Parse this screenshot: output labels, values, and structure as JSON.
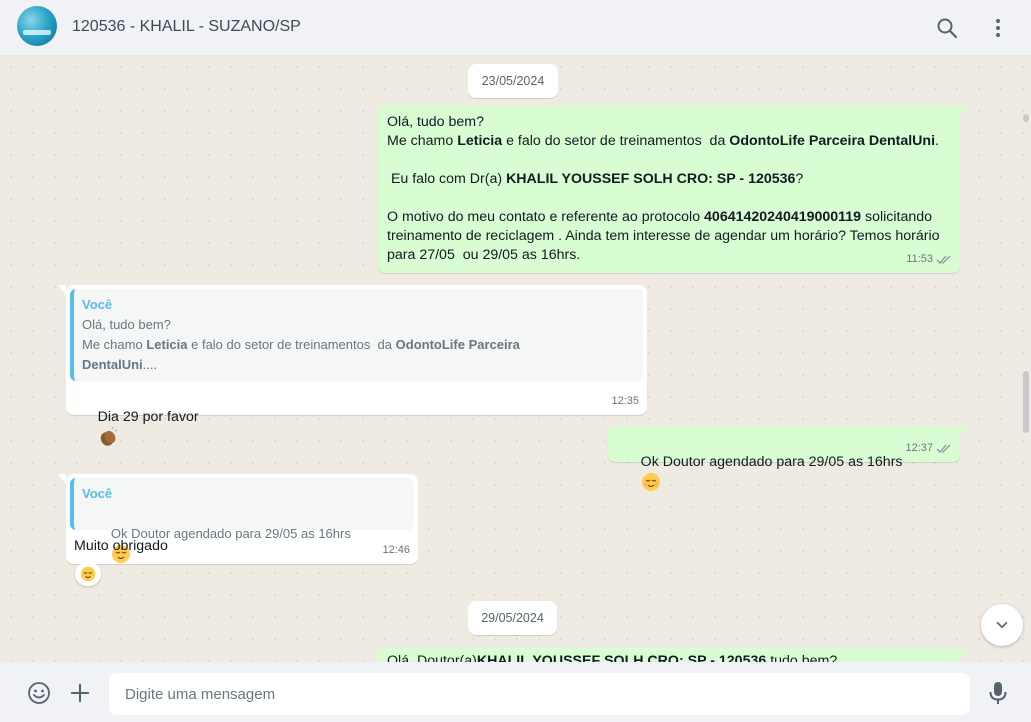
{
  "header": {
    "title": "120536 - KHALIL - SUZANO/SP",
    "search_icon": "search-icon",
    "menu_icon": "menu-dots-icon"
  },
  "chat": {
    "date_1": "23/05/2024",
    "date_2": "29/05/2024",
    "msg1": {
      "l1": "Olá, tudo bem?",
      "l2a": "Me chamo ",
      "l2b": "Leticia",
      "l2c": " e falo do setor de treinamentos  da ",
      "l2d": "OdontoLife Parceira DentalUni",
      "l2e": ".",
      "l3a": " Eu falo com Dr(a) ",
      "l3b": "KHALIL YOUSSEF SOLH CRO: SP - 120536",
      "l3c": "?",
      "l4a": "O motivo do meu contato e referente ao protocolo ",
      "l4b": "40641420240419000119",
      "l4c": " solicitando",
      "l5": "treinamento de reciclagem . Ainda tem interesse de agendar um horário? Temos horário",
      "l6": "para 27/05  ou 29/05 as 16hrs.",
      "time": "11:53"
    },
    "msg2": {
      "quote_author": "Você",
      "q1": "Olá, tudo bem?",
      "q2a": "Me chamo ",
      "q2b": "Leticia",
      "q2c": " e falo do setor de treinamentos  da ",
      "q2d": "OdontoLife Parceira",
      "q3a": "DentalUni",
      "q3b": "....",
      "text": "Dia 29 por favor",
      "time": "12:35"
    },
    "msg3": {
      "text": "Ok Doutor agendado para 29/05 as 16hrs",
      "time": "12:37"
    },
    "msg4": {
      "quote_author": "Você",
      "quote_text": "Ok Doutor agendado para 29/05 as 16hrs",
      "text": "Muito obrigado",
      "time": "12:46"
    },
    "msg5": {
      "preview_a": "Olá, Doutor(a)",
      "preview_b": "KHALIL YOUSSEF SOLH CRO: SP - 120536",
      "preview_c": " tudo bem?"
    }
  },
  "footer": {
    "placeholder": "Digite uma mensagem"
  },
  "colors": {
    "outgoing": "#d9fdd3",
    "incoming": "#ffffff",
    "quote_accent": "#53bdeb",
    "background": "#efeae2"
  }
}
